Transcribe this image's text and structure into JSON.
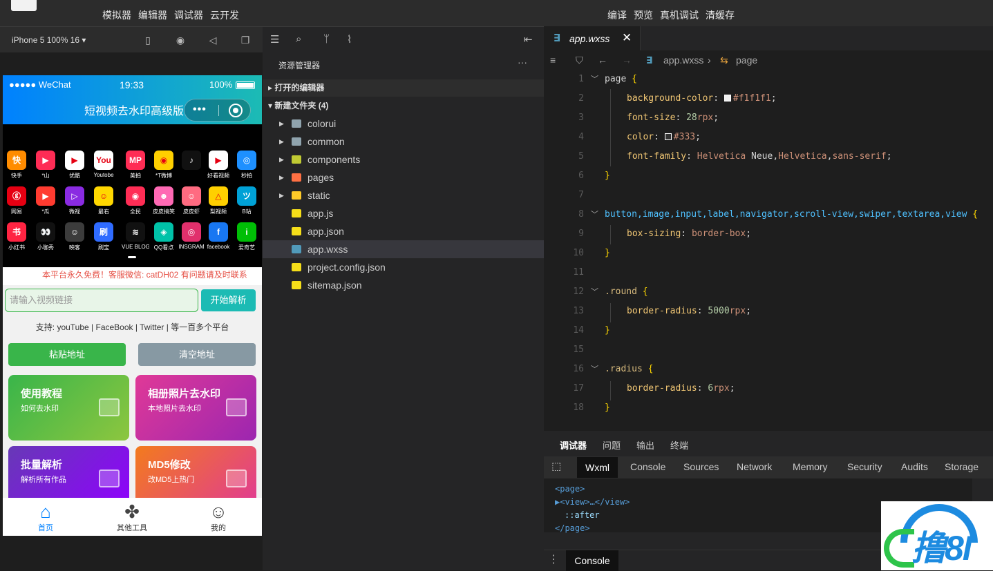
{
  "topbar": {
    "left_menu": [
      "模拟器",
      "编辑器",
      "调试器",
      "云开发"
    ],
    "right_menu": [
      "编译",
      "预览",
      "真机调试",
      "清缓存"
    ]
  },
  "simulator": {
    "device": "iPhone 5 100% 16 ▾",
    "status": {
      "signal": "●●●●● WeChat",
      "time": "19:33",
      "battery": "100%"
    },
    "nav_title": "短视频去水印高级版",
    "capsule_dots": "•••",
    "apps": [
      {
        "label": "快手",
        "color": "#ff8c00",
        "glyph": "快"
      },
      {
        "label": "*山",
        "color": "#fe2c55",
        "glyph": "▶"
      },
      {
        "label": "优酷",
        "color": "#ffffff",
        "glyph": "▶"
      },
      {
        "label": "Youtobe",
        "color": "#ffffff",
        "glyph": "You"
      },
      {
        "label": "美拍",
        "color": "#ff2d55",
        "glyph": "MP"
      },
      {
        "label": "*T微博",
        "color": "#ffd000",
        "glyph": "◉"
      },
      {
        "label": "",
        "color": "#111111",
        "glyph": "♪"
      },
      {
        "label": "好看视频",
        "color": "#ffffff",
        "glyph": "▶"
      },
      {
        "label": "秒拍",
        "color": "#1e90ff",
        "glyph": "◎"
      },
      {
        "label": "网易",
        "color": "#e60012",
        "glyph": "ⓖ"
      },
      {
        "label": "*瓜",
        "color": "#ff3b30",
        "glyph": "▶"
      },
      {
        "label": "微视",
        "color": "#8a2be2",
        "glyph": "▷"
      },
      {
        "label": "最右",
        "color": "#ffd700",
        "glyph": "☺"
      },
      {
        "label": "全民",
        "color": "#ff2d55",
        "glyph": "◉"
      },
      {
        "label": "皮皮搞笑",
        "color": "#ff69b4",
        "glyph": "☻"
      },
      {
        "label": "皮皮虾",
        "color": "#ff6b81",
        "glyph": "☺"
      },
      {
        "label": "梨视频",
        "color": "#ffd000",
        "glyph": "△"
      },
      {
        "label": "B站",
        "color": "#00a1d6",
        "glyph": "ツ"
      },
      {
        "label": "小红书",
        "color": "#ff2442",
        "glyph": "书"
      },
      {
        "label": "小咖秀",
        "color": "#111111",
        "glyph": "👀"
      },
      {
        "label": "映客",
        "color": "#3c3c3c",
        "glyph": "☺"
      },
      {
        "label": "刷宝",
        "color": "#2f6bff",
        "glyph": "刷"
      },
      {
        "label": "VUE BLOG",
        "color": "#111111",
        "glyph": "≋"
      },
      {
        "label": "QQ看点",
        "color": "#00c2a8",
        "glyph": "◈"
      },
      {
        "label": "INSGRAM",
        "color": "#e1306c",
        "glyph": "◎"
      },
      {
        "label": "facebook",
        "color": "#1877f2",
        "glyph": "f"
      },
      {
        "label": "爱奇艺",
        "color": "#00be06",
        "glyph": "i"
      }
    ],
    "notice": "本平台永久免费！客服微信: catDH02 有问题请及时联系",
    "search_placeholder": "请输入视频链接",
    "parse_button": "开始解析",
    "support": "支持:  youTube | FaceBook | Twitter | 等一百多个平台",
    "paste_button": "粘贴地址",
    "clear_button": "清空地址",
    "cards": [
      {
        "title": "使用教程",
        "sub": "如何去水印"
      },
      {
        "title": "相册照片去水印",
        "sub": "本地照片去水印"
      },
      {
        "title": "批量解析",
        "sub": "解析所有作品"
      },
      {
        "title": "MD5修改",
        "sub": "改MD5上热门"
      }
    ],
    "tabs": [
      "首页",
      "其他工具",
      "我的"
    ]
  },
  "explorer": {
    "title": "资源管理器",
    "more": "···",
    "open_editors": "打开的编辑器",
    "folder": "新建文件夹 (4)",
    "items": [
      {
        "name": "colorui",
        "color": "#90a4ae",
        "arrow": "▶"
      },
      {
        "name": "common",
        "color": "#90a4ae",
        "arrow": "▶"
      },
      {
        "name": "components",
        "color": "#c0ca33",
        "arrow": "▶"
      },
      {
        "name": "pages",
        "color": "#ff7043",
        "arrow": "▶"
      },
      {
        "name": "static",
        "color": "#ffca28",
        "arrow": "▶"
      },
      {
        "name": "app.js",
        "color": "#f5de19",
        "arrow": ""
      },
      {
        "name": "app.json",
        "color": "#f5de19",
        "arrow": ""
      },
      {
        "name": "app.wxss",
        "color": "#519aba",
        "arrow": ""
      },
      {
        "name": "project.config.json",
        "color": "#f5de19",
        "arrow": ""
      },
      {
        "name": "sitemap.json",
        "color": "#f5de19",
        "arrow": ""
      }
    ]
  },
  "editor": {
    "tab": "app.wxss",
    "breadcrumb": [
      "app.wxss",
      "page"
    ],
    "lines": [
      "1",
      "2",
      "3",
      "4",
      "5",
      "6",
      "7",
      "8",
      "9",
      "10",
      "11",
      "12",
      "13",
      "14",
      "15",
      "16",
      "17",
      "18"
    ]
  },
  "debug": {
    "tabs": [
      "调试器",
      "问题",
      "输出",
      "终端"
    ],
    "devtabs": [
      "Wxml",
      "Console",
      "Sources",
      "Network",
      "Memory",
      "Security",
      "Audits",
      "Storage"
    ],
    "wxml": [
      "<page>",
      "▶<view>…</view>",
      "::after",
      "</page>"
    ],
    "console": "Console"
  },
  "watermark": "撸8I"
}
